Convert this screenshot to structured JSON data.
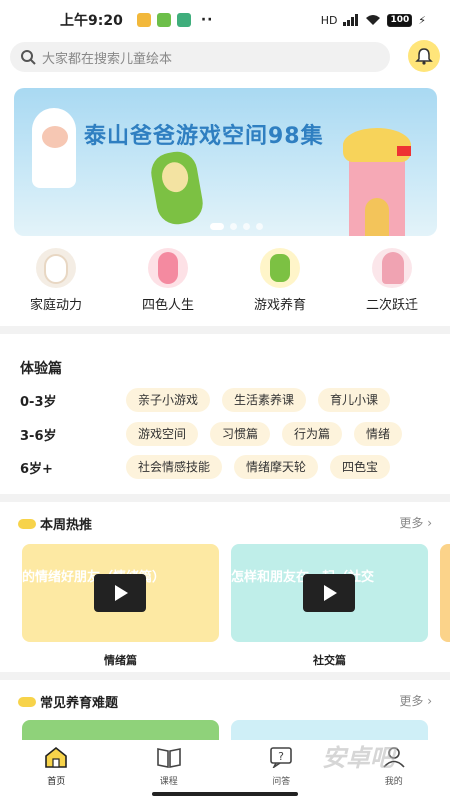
{
  "status_bar": {
    "time": "上午9:20",
    "dots": "··",
    "signal": "HD",
    "battery": "100"
  },
  "search": {
    "placeholder": "大家都在搜索儿童绘本"
  },
  "banner": {
    "title": "泰山爸爸游戏空间98集",
    "page_count": 4,
    "active_page": 1
  },
  "categories": [
    {
      "label": "家庭动力",
      "icon": "family-illustration"
    },
    {
      "label": "四色人生",
      "icon": "girl-illustration"
    },
    {
      "label": "游戏养育",
      "icon": "play-illustration"
    },
    {
      "label": "二次跃迁",
      "icon": "leap-illustration"
    }
  ],
  "experience": {
    "title": "体验篇",
    "rows": [
      {
        "age": "0-3岁",
        "tags": [
          "亲子小游戏",
          "生活素养课",
          "育儿小课"
        ]
      },
      {
        "age": "3-6岁",
        "tags": [
          "游戏空间",
          "习惯篇",
          "行为篇",
          "情绪"
        ]
      },
      {
        "age": "6岁+",
        "tags": [
          "社会情感技能",
          "情绪摩天轮",
          "四色宝"
        ]
      }
    ]
  },
  "hot": {
    "title": "本周热推",
    "more": "更多",
    "videos": [
      {
        "overlay": "的情绪好朋友（情绪篇）",
        "label": "情绪篇",
        "bg": "#fde9a3"
      },
      {
        "overlay": "怎样和朋友在一起（社交",
        "label": "社交篇",
        "bg": "#bfeee9"
      }
    ]
  },
  "problems": {
    "title": "常见养育难题",
    "more": "更多"
  },
  "nav": [
    {
      "label": "首页",
      "icon": "home-icon",
      "active": true
    },
    {
      "label": "课程",
      "icon": "book-icon"
    },
    {
      "label": "问答",
      "icon": "question-icon"
    },
    {
      "label": "我的",
      "icon": "profile-icon"
    }
  ],
  "watermark": "安卓吧",
  "colors": {
    "accent": "#f7d34a",
    "tag_bg": "#fdf3dc",
    "banner_title": "#2f7fc1"
  }
}
